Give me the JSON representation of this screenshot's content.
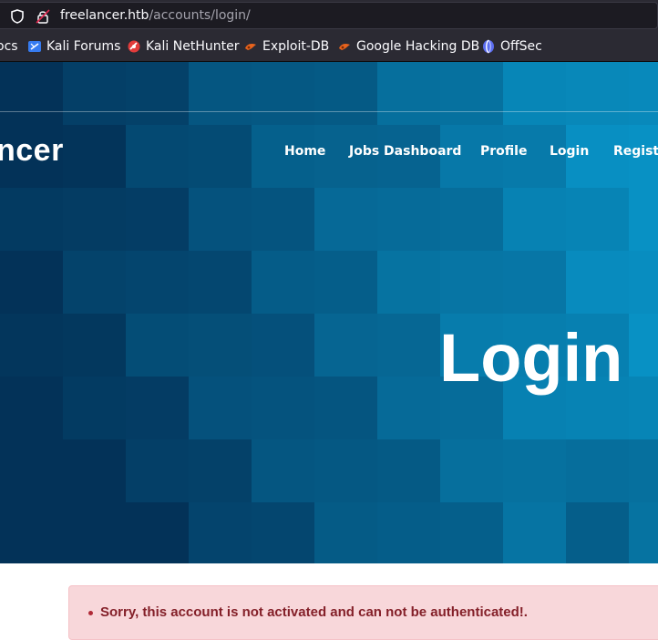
{
  "browser": {
    "url_host": "freelancer.htb",
    "url_path": "/accounts/login/",
    "bookmarks": [
      {
        "label": "ocs",
        "icon": "docs-icon"
      },
      {
        "label": "Kali Forums",
        "icon": "kali-forums-icon"
      },
      {
        "label": "Kali NetHunter",
        "icon": "kali-nethunter-icon"
      },
      {
        "label": "Exploit-DB",
        "icon": "exploit-db-icon"
      },
      {
        "label": "Google Hacking DB",
        "icon": "ghdb-icon"
      },
      {
        "label": "OffSec",
        "icon": "offsec-icon"
      }
    ]
  },
  "site": {
    "brand": "ncer",
    "nav": [
      "Home",
      "Jobs Dashboard",
      "Profile",
      "Login",
      "Registe"
    ]
  },
  "hero": {
    "title": "Login"
  },
  "alert": {
    "message": "Sorry, this account is not activated and can not be authenticated!."
  },
  "colors": {
    "hero_dark": "#033a5e",
    "hero_light": "#0a91c4",
    "alert_bg": "#f8d7da",
    "alert_text": "#842029"
  }
}
